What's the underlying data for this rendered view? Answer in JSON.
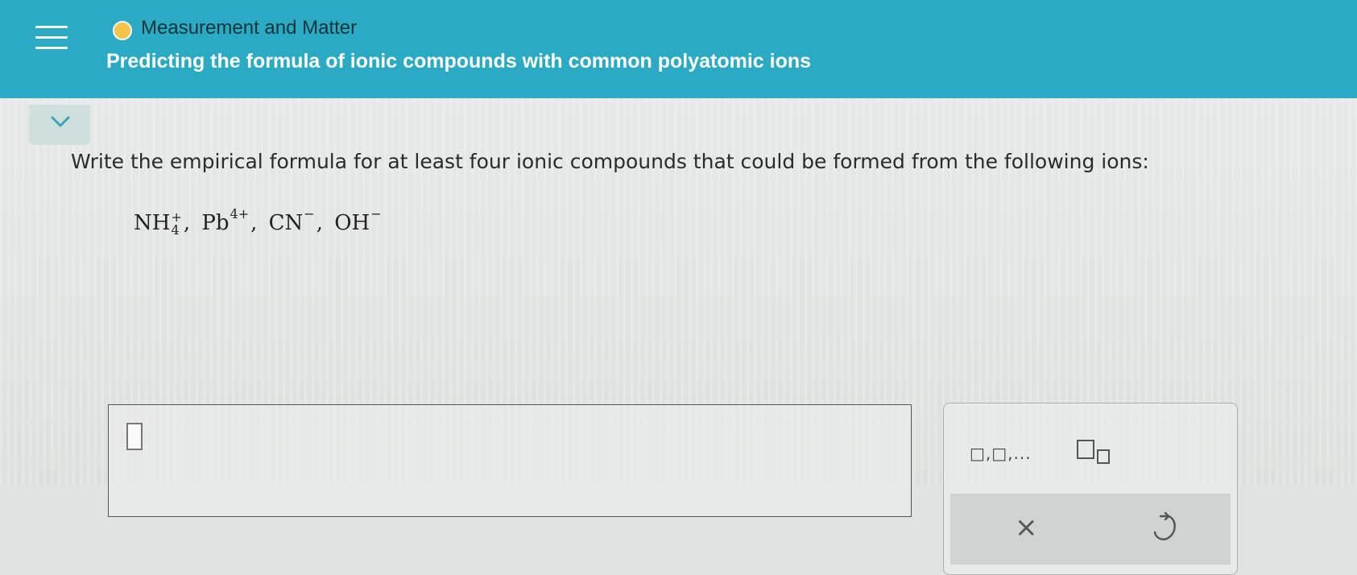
{
  "header": {
    "topic": "Measurement and Matter",
    "title": "Predicting the formula of ionic compounds with common polyatomic ions"
  },
  "question": {
    "prompt": "Write the empirical formula for at least four ionic compounds that could be formed from the following ions:",
    "ions": [
      {
        "base": "NH",
        "sub": "4",
        "charge": "+"
      },
      {
        "base": "Pb",
        "sub": "",
        "charge": "4+"
      },
      {
        "base": "CN",
        "sub": "",
        "charge": "−"
      },
      {
        "base": "OH",
        "sub": "",
        "charge": "−"
      }
    ]
  },
  "answer": {
    "value": ""
  },
  "palette": {
    "list_tool_label": "□,□,...",
    "subscript_tool_icon": "subscript-template-icon",
    "clear_label": "×",
    "undo_icon": "undo-icon"
  },
  "colors": {
    "header_bg": "#2aaac3",
    "topic_dot": "#f3c34a",
    "title_text": "#ffffff",
    "topic_text": "#17343c"
  }
}
